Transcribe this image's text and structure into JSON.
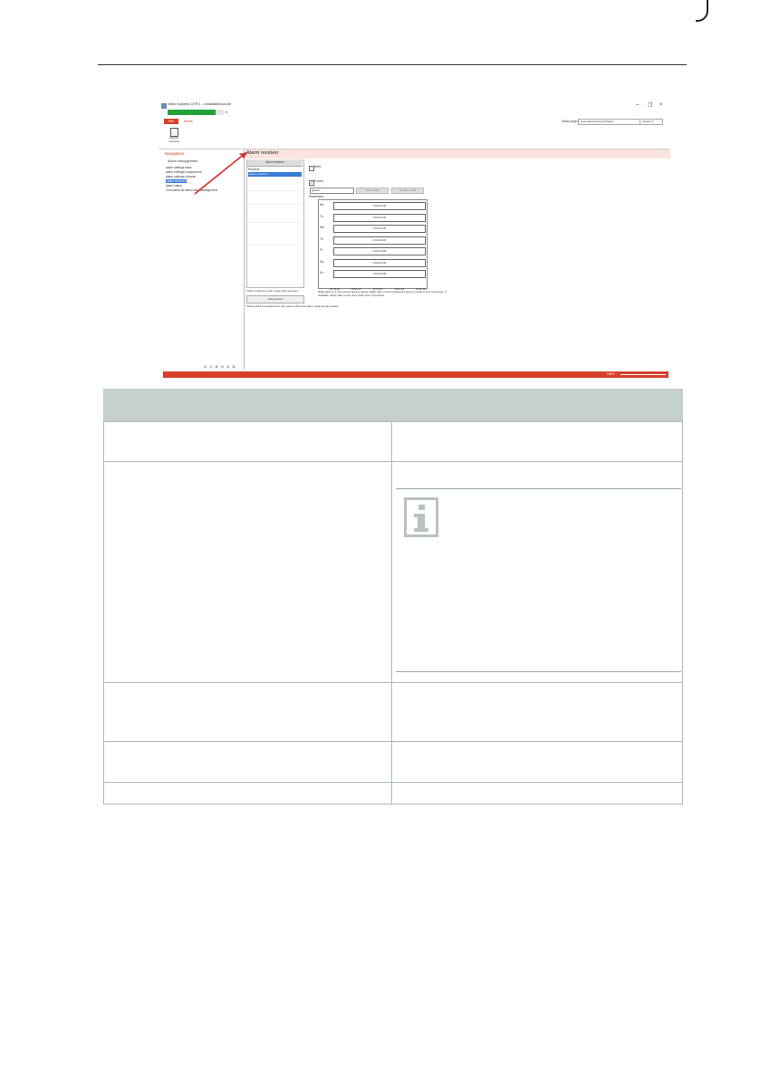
{
  "screenshot": {
    "title": "testo Saveris CFR 1 - Installationszone",
    "progress_value": 0.85,
    "progress_text": "0",
    "window_controls": {
      "minimize": "–",
      "restore": "❐",
      "close": "×"
    },
    "tabs": [
      "File",
      "Extras"
    ],
    "project_label": "Select project",
    "project_value": "testo Saveris Demo Project",
    "version_value": "Version 1",
    "ribbon_button": "Display overview",
    "navigation": {
      "title": "Navigation",
      "pin": "◂",
      "group": "Alarm management",
      "items": [
        "alarm settings base",
        "alarm settings components",
        "alarm settings channel",
        "alarm receiver",
        "alarm status",
        "Comments for alarm acknowledgement"
      ],
      "selected_index": 3,
      "footer_icons": "▤ ▥ ▦ ▧ ▨ ▩"
    },
    "content_title": "Alarm receiver",
    "list_button": "Alarm receiver",
    "list_header": "Receiver",
    "list_selected": "Alarm receiver 1",
    "list_note": "Click on Name to edit, group with receivers",
    "add_button": "Add receiver",
    "setting_note": "Setting will be transferred to the system when the alarm receivers are saved.",
    "sms_label": "SMS",
    "email_label": "E-mail",
    "email_check": "✓",
    "email_value": "@testo",
    "button_a": "Test e-mail",
    "button_b": "Delete e-mail",
    "readiness_label": "Readiness",
    "days": [
      "Mo",
      "Tu",
      "We",
      "Th",
      "Fr",
      "Sa",
      "Su"
    ],
    "day_value": "0:00-24:00",
    "time_ticks": [
      "00:00:00",
      "06:00:00",
      "12:00:00",
      "18:00:00",
      "24:00:00"
    ],
    "grid_note": "Right click on a time period area to delete. Right click on the unassigned area to create a new timerange, if available. Right click to use drop-down lists of Symbols.",
    "zoom": "100%",
    "colors": {
      "accent": "#d6402b",
      "selection": "#3a7bd5",
      "progress": "#22a33a"
    }
  },
  "table": {
    "header_color": "#c5cfcd",
    "note_icon": "info-icon"
  }
}
